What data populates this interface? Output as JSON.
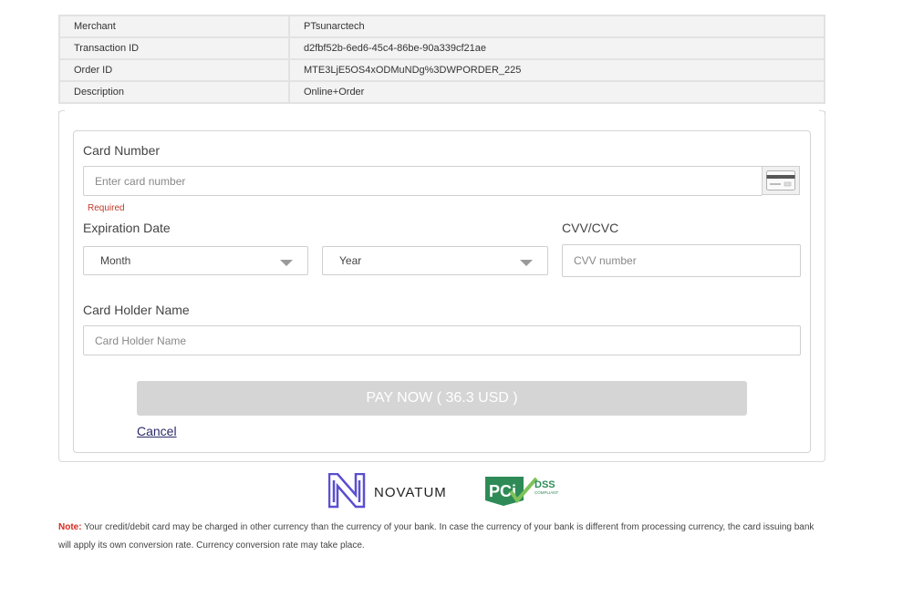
{
  "transaction": {
    "rows": [
      {
        "key": "Merchant",
        "value": "PTsunarctech"
      },
      {
        "key": "Transaction ID",
        "value": "d2fbf52b-6ed6-45c4-86be-90a339cf21ae"
      },
      {
        "key": "Order ID",
        "value": "MTE3LjE5OS4xODMuNDg%3DWPORDER_225"
      },
      {
        "key": "Description",
        "value": "Online+Order"
      }
    ]
  },
  "form": {
    "card_number_label": "Card Number",
    "card_number_placeholder": "Enter card number",
    "required_text": "Required",
    "expiration_label": "Expiration Date",
    "month_value": "Month",
    "year_value": "Year",
    "cvv_label": "CVV/CVC",
    "cvv_placeholder": "CVV number",
    "holder_label": "Card Holder Name",
    "holder_placeholder": "Card Holder Name",
    "pay_button": "PAY NOW ( 36.3 USD )",
    "cancel_link": "Cancel"
  },
  "logos": {
    "novatum": "NOVATUM",
    "pci": "PCi",
    "dss": "DSS",
    "compliant": "COMPLIANT"
  },
  "note": {
    "label": "Note:",
    "text": "Your credit/debit card may be charged in other currency than the currency of your bank. In case the currency of your bank is different from processing currency, the card issuing bank will apply its own conversion rate. Currency conversion rate may take place."
  },
  "colors": {
    "note_label": "#d9281e",
    "novatum_purple": "#5a4fcf",
    "pci_green": "#2e8b57",
    "pay_button_bg": "#d5d5d5"
  }
}
